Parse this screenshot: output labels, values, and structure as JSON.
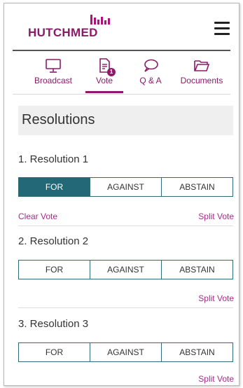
{
  "brand": {
    "name": "HUTCHMED",
    "color": "#8c1a68"
  },
  "tabs": [
    {
      "label": "Broadcast",
      "icon": "monitor-icon"
    },
    {
      "label": "Vote",
      "icon": "document-icon",
      "badge": "1",
      "active": true
    },
    {
      "label": "Q & A",
      "icon": "chat-bubble-icon"
    },
    {
      "label": "Documents",
      "icon": "folder-icon"
    }
  ],
  "section": {
    "title": "Resolutions"
  },
  "resolutions": [
    {
      "title": "1. Resolution 1",
      "options": [
        "FOR",
        "AGAINST",
        "ABSTAIN"
      ],
      "selected": "FOR",
      "clear_vote": "Clear Vote",
      "split_vote": "Split Vote"
    },
    {
      "title": "2. Resolution 2",
      "options": [
        "FOR",
        "AGAINST",
        "ABSTAIN"
      ],
      "selected": null,
      "split_vote": "Split Vote"
    },
    {
      "title": "3. Resolution 3",
      "options": [
        "FOR",
        "AGAINST",
        "ABSTAIN"
      ],
      "selected": null,
      "split_vote": "Split Vote"
    }
  ],
  "colors": {
    "accent": "#8c1a68",
    "link": "#a52c8a",
    "selected_vote": "#226876"
  }
}
